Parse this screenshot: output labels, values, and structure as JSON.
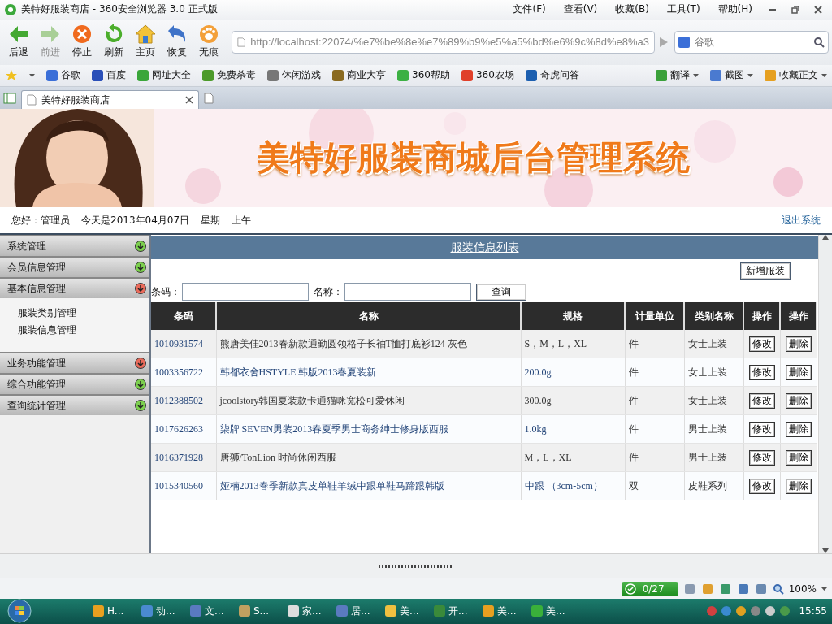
{
  "browser": {
    "title": "美特好服装商店 - 360安全浏览器 3.0 正式版",
    "menu": [
      "文件(F)",
      "查看(V)",
      "收藏(B)",
      "工具(T)",
      "帮助(H)"
    ],
    "nav_buttons": [
      {
        "label": "后退",
        "kind": "back",
        "disabled": false
      },
      {
        "label": "前进",
        "kind": "forward",
        "disabled": true
      },
      {
        "label": "停止",
        "kind": "stop",
        "disabled": false
      },
      {
        "label": "刷新",
        "kind": "refresh",
        "disabled": false
      },
      {
        "label": "主页",
        "kind": "home",
        "disabled": false
      },
      {
        "label": "恢复",
        "kind": "restore",
        "disabled": false
      },
      {
        "label": "无痕",
        "kind": "private",
        "disabled": false
      }
    ],
    "address": {
      "value": "http://localhost:22074/%e7%be%8e%e7%89%b9%e5%a5%bd%e6%9c%8d%e8%a3"
    },
    "search": {
      "placeholder": "谷歌"
    },
    "bookmarks": [
      {
        "label": "谷歌",
        "color": "#3b6fd8"
      },
      {
        "label": "百度",
        "color": "#2a4fb8"
      },
      {
        "label": "网址大全",
        "color": "#3aa63a"
      },
      {
        "label": "免费杀毒",
        "color": "#4c9a2a"
      },
      {
        "label": "休闲游戏",
        "color": "#777777"
      },
      {
        "label": "商业大亨",
        "color": "#8a6a20"
      },
      {
        "label": "360帮助",
        "color": "#3cb043"
      },
      {
        "label": "360农场",
        "color": "#e0402a"
      },
      {
        "label": "奇虎问答",
        "color": "#1c5fb0"
      }
    ],
    "bookmark_tools": [
      "翻译",
      "截图",
      "收藏正文"
    ],
    "tabs": [
      {
        "label": "美特好服装商店",
        "selected": true
      }
    ]
  },
  "page": {
    "banner_title": "美特好服装商城后台管理系统",
    "greeting": "您好：管理员",
    "date": "今天是2013年04月07日",
    "weekday": "星期",
    "period": "上午",
    "logout": "退出系统",
    "sidebar": [
      {
        "label": "系统管理",
        "color": "#7ccf4e",
        "expanded": false
      },
      {
        "label": "会员信息管理",
        "color": "#7ccf4e",
        "expanded": false
      },
      {
        "label": "基本信息管理",
        "color": "#e86a5a",
        "expanded": true,
        "children": [
          "服装类别管理",
          "服装信息管理"
        ]
      },
      {
        "label": "业务功能管理",
        "color": "#e86a5a",
        "expanded": false
      },
      {
        "label": "综合功能管理",
        "color": "#7ccf4e",
        "expanded": false
      },
      {
        "label": "查询统计管理",
        "color": "#7ccf4e",
        "expanded": false
      }
    ],
    "list_title": "服装信息列表",
    "add_button": "新增服装",
    "filters": [
      {
        "label": "条码："
      },
      {
        "label": "名称："
      }
    ],
    "query_button": "查询",
    "table": {
      "columns": [
        "条码",
        "名称",
        "规格",
        "计量单位",
        "类别名称",
        "操作",
        "操作"
      ],
      "rows": [
        {
          "cells": [
            "1010931574",
            "熊唐美佳2013春新款通勤圆领格子长袖T恤打底衫124 灰色",
            "S，M，L，XL",
            "件",
            "女士上装"
          ],
          "actions": [
            "修改",
            "删除"
          ]
        },
        {
          "cells": [
            "1003356722",
            "韩都衣舍HSTYLE 韩版2013春夏装新",
            "200.0g",
            "件",
            "女士上装"
          ],
          "actions": [
            "修改",
            "删除"
          ]
        },
        {
          "cells": [
            "1012388502",
            "jcoolstory韩国夏装款卡通猫咪宽松可爱休闲",
            "300.0g",
            "件",
            "女士上装"
          ],
          "actions": [
            "修改",
            "删除"
          ]
        },
        {
          "cells": [
            "1017626263",
            "柒牌  SEVEN男装2013春夏季男士商务绅士修身版西服",
            "1.0kg",
            "件",
            "男士上装"
          ],
          "actions": [
            "修改",
            "删除"
          ]
        },
        {
          "cells": [
            "1016371928",
            "唐狮/TonLion 时尚休闲西服",
            "M，L，XL",
            "件",
            "男士上装"
          ],
          "actions": [
            "修改",
            "删除"
          ]
        },
        {
          "cells": [
            "1015340560",
            "娅楠2013春季新款真皮单鞋羊绒中跟单鞋马蹄跟韩版",
            "中跟 （3cm-5cm）",
            "双",
            "皮鞋系列"
          ],
          "actions": [
            "修改",
            "删除"
          ]
        }
      ]
    }
  },
  "status_bar": {
    "counter": "0/27",
    "zoom": "100%"
  },
  "taskbar": {
    "tasks": [
      "H...",
      "动...",
      "文...",
      "S...",
      "家...",
      "居...",
      "美...",
      "开...",
      "美...",
      "美..."
    ],
    "clock": "15:55"
  }
}
